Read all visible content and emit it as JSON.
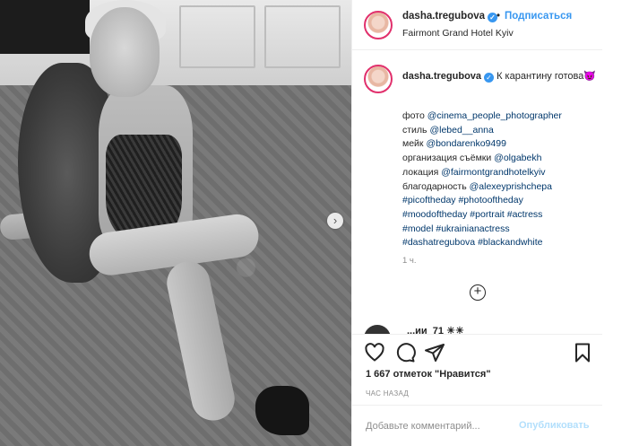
{
  "post": {
    "username": "dasha.tregubova",
    "follow_label": "Подписаться",
    "dot": "•",
    "location": "Fairmont Grand Hotel Kyiv"
  },
  "caption": {
    "username": "dasha.tregubova",
    "text": "К карантину готова😈",
    "lines": [
      {
        "label": "фото ",
        "link": "@cinema_people_photographer"
      },
      {
        "label": "стиль ",
        "link": "@lebed__anna"
      },
      {
        "label": "мейк ",
        "link": "@bondarenko9499"
      },
      {
        "label": "организация съёмки ",
        "link": "@olgabekh"
      },
      {
        "label": "локация ",
        "link": "@fairmontgrandhotelkyiv"
      },
      {
        "label": "благодарность ",
        "link": "@alexeyprishchepa"
      },
      {
        "label": "",
        "link": "#picoftheday #photooftheday"
      },
      {
        "label": "",
        "link": "#moodoftheday #portrait #actress"
      },
      {
        "label": "",
        "link": "#model #ukrainianactress"
      },
      {
        "label": "",
        "link": "#dashatregubova #blackandwhite"
      }
    ],
    "time": "1 ч."
  },
  "load_more": "+",
  "partial_comment": "...ии_71 ☀☀",
  "actions": {
    "likes": "1 667 отметок \"Нравится\"",
    "ago": "ЧАС НАЗАД"
  },
  "comment_form": {
    "placeholder": "Добавьте комментарий...",
    "publish_label": "Опубликовать"
  },
  "icons": {
    "like": "heart-icon",
    "comment": "comment-icon",
    "share": "share-icon",
    "save": "bookmark-icon",
    "verified": "verified-badge-icon",
    "next": "chevron-right-icon"
  },
  "colors": {
    "link": "#00376b",
    "follow": "#3897f0",
    "muted": "#8e8e8e",
    "publish_disabled": "#b2dffc"
  }
}
